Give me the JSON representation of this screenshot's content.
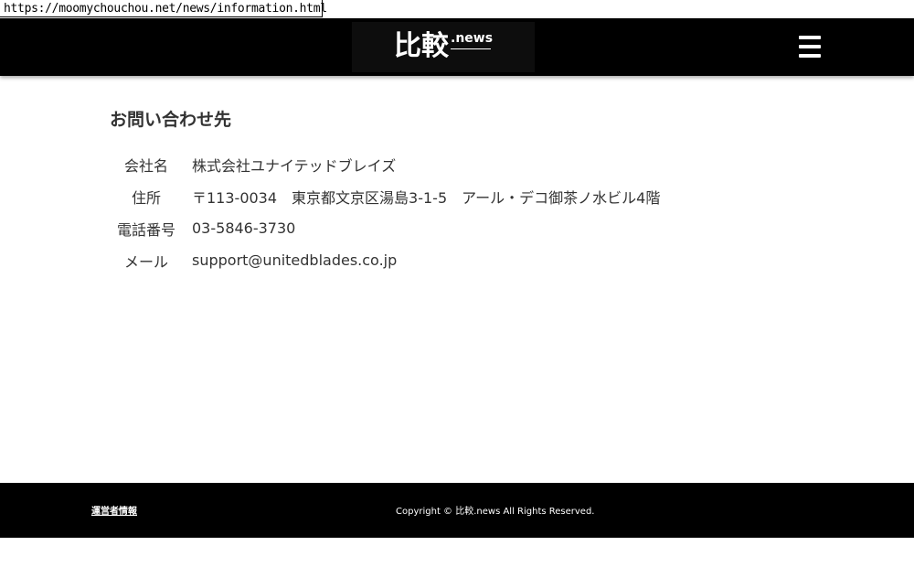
{
  "browser": {
    "url": "https://moomychouchou.net/news/information.html"
  },
  "header": {
    "logo_kanji": "比較",
    "logo_suffix": ".news",
    "menu_icon": "hamburger-menu-icon"
  },
  "main": {
    "heading": "お問い合わせ先",
    "rows": [
      {
        "label": "会社名",
        "value": "株式会社ユナイテッドブレイズ"
      },
      {
        "label": "住所",
        "value": "〒113-0034　東京都文京区湯島3-1-5　アール・デコ御茶ノ水ビル4階"
      },
      {
        "label": "電話番号",
        "value": "03-5846-3730"
      },
      {
        "label": "メール",
        "value": "support@unitedblades.co.jp"
      }
    ]
  },
  "footer": {
    "operator_link": "運営者情報",
    "copyright": "Copyright © 比較.news All Rights Reserved."
  },
  "colors": {
    "header_bg": "#000000",
    "footer_bg": "#000000",
    "text": "#333333",
    "page_bg": "#ffffff"
  }
}
